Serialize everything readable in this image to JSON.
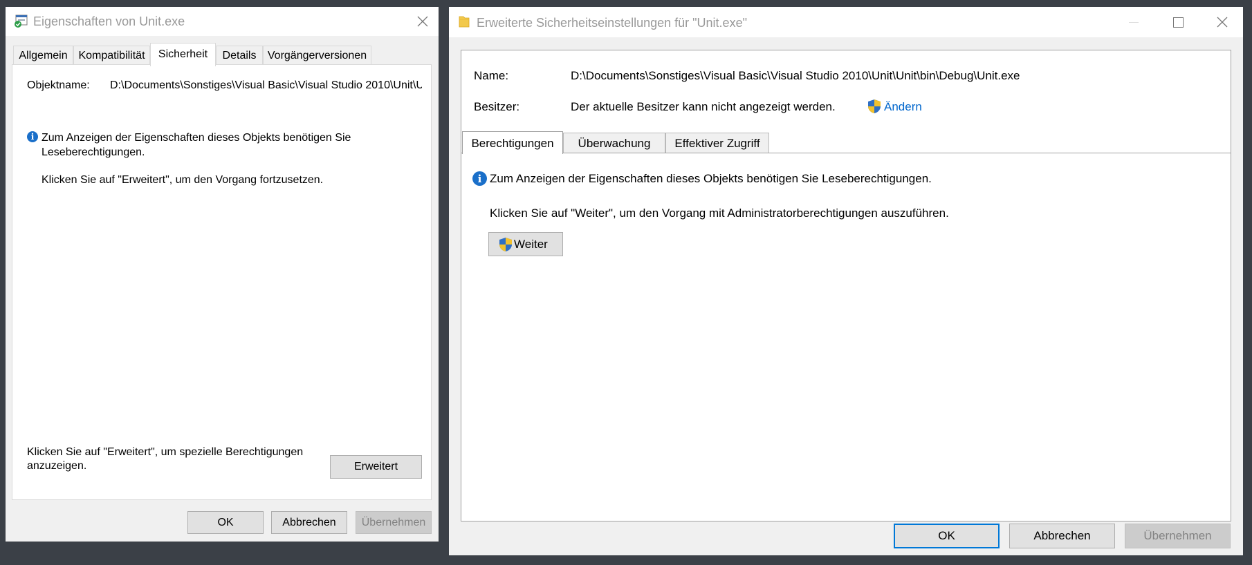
{
  "left_window": {
    "title": "Eigenschaften von Unit.exe",
    "tabs": [
      "Allgemein",
      "Kompatibilität",
      "Sicherheit",
      "Details",
      "Vorgängerversionen"
    ],
    "active_tab": "Sicherheit",
    "object_label": "Objektname:",
    "object_value": "D:\\Documents\\Sonstiges\\Visual Basic\\Visual Studio 2010\\Unit\\U",
    "info_line1": "Zum Anzeigen der Eigenschaften dieses Objekts benötigen Sie",
    "info_line2": "Leseberechtigungen.",
    "advanced_hint": "Klicken Sie auf \"Erweitert\", um den Vorgang fortzusetzen.",
    "special_line1": "Klicken Sie auf \"Erweitert\", um spezielle Berechtigungen",
    "special_line2": "anzuzeigen.",
    "advanced_button": "Erweitert",
    "ok_button": "OK",
    "cancel_button": "Abbrechen",
    "apply_button": "Übernehmen"
  },
  "right_window": {
    "title": "Erweiterte Sicherheitseinstellungen für \"Unit.exe\"",
    "name_label": "Name:",
    "name_value": "D:\\Documents\\Sonstiges\\Visual Basic\\Visual Studio 2010\\Unit\\Unit\\bin\\Debug\\Unit.exe",
    "owner_label": "Besitzer:",
    "owner_value": "Der aktuelle Besitzer kann nicht angezeigt werden.",
    "change_link": "Ändern",
    "tabs": [
      "Berechtigungen",
      "Überwachung",
      "Effektiver Zugriff"
    ],
    "active_tab": "Berechtigungen",
    "info_text": "Zum Anzeigen der Eigenschaften dieses Objekts benötigen Sie Leseberechtigungen.",
    "continue_hint": "Klicken Sie auf \"Weiter\", um den Vorgang mit Administratorberechtigungen auszuführen.",
    "continue_button": "Weiter",
    "ok_button": "OK",
    "cancel_button": "Abbrechen",
    "apply_button": "Übernehmen"
  },
  "colors": {
    "desktop": "#3b4047",
    "accent": "#0078d7",
    "link": "#0066cc",
    "info_blue": "#1a6fc9"
  }
}
